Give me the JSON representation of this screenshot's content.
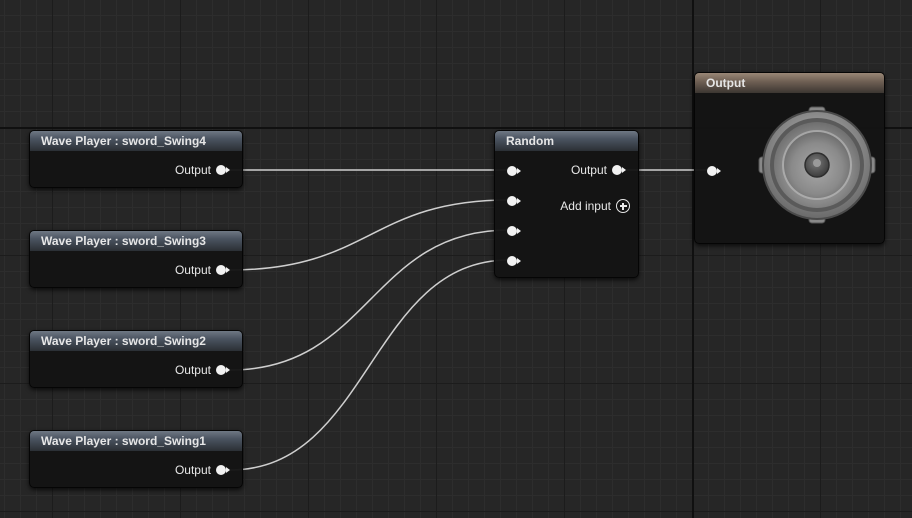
{
  "wave_players": [
    {
      "title": "Wave Player : sword_Swing4",
      "output_label": "Output"
    },
    {
      "title": "Wave Player : sword_Swing3",
      "output_label": "Output"
    },
    {
      "title": "Wave Player : sword_Swing2",
      "output_label": "Output"
    },
    {
      "title": "Wave Player : sword_Swing1",
      "output_label": "Output"
    }
  ],
  "random_node": {
    "title": "Random",
    "output_label": "Output",
    "add_input_label": "Add input"
  },
  "output_node": {
    "title": "Output",
    "icon": "speaker-icon"
  },
  "colors": {
    "wire": "#cfcfcf",
    "pin": "#f2f2f2",
    "header_sound_node": "#4a5360",
    "header_output_node": "#6d5e52",
    "grid_background": "#262626"
  }
}
